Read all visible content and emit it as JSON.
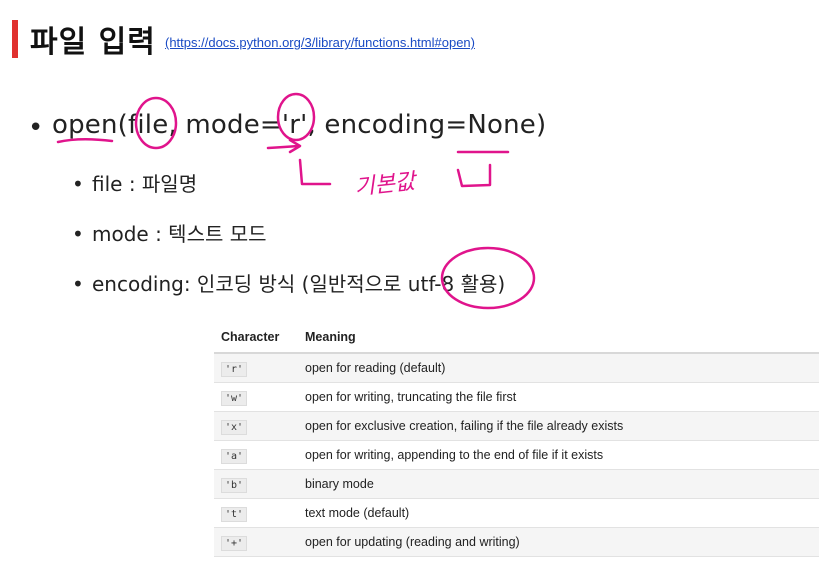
{
  "header": {
    "title": "파일 입력",
    "link": "(https://docs.python.org/3/library/functions.html#open)"
  },
  "main_line": {
    "bullet": "•",
    "text": "open(file, mode='r', encoding=None)"
  },
  "sub_items": [
    {
      "bullet": "•",
      "text": "file : 파일명"
    },
    {
      "bullet": "•",
      "text": "mode : 텍스트 모드"
    },
    {
      "bullet": "•",
      "text": "encoding: 인코딩 방식 (일반적으로 utf-8 활용)"
    }
  ],
  "handwriting": {
    "note": "기본값",
    "color": "#e0148c"
  },
  "table": {
    "headers": [
      "Character",
      "Meaning"
    ],
    "rows": [
      {
        "char": "'r'",
        "meaning": "open for reading (default)"
      },
      {
        "char": "'w'",
        "meaning": "open for writing, truncating the file first"
      },
      {
        "char": "'x'",
        "meaning": "open for exclusive creation, failing if the file already exists"
      },
      {
        "char": "'a'",
        "meaning": "open for writing, appending to the end of file if it exists"
      },
      {
        "char": "'b'",
        "meaning": "binary mode"
      },
      {
        "char": "'t'",
        "meaning": "text mode (default)"
      },
      {
        "char": "'+'",
        "meaning": "open for updating (reading and writing)"
      }
    ]
  },
  "colors": {
    "accent": "#e0312f",
    "link": "#1a4bc4",
    "annotation": "#e0148c"
  }
}
